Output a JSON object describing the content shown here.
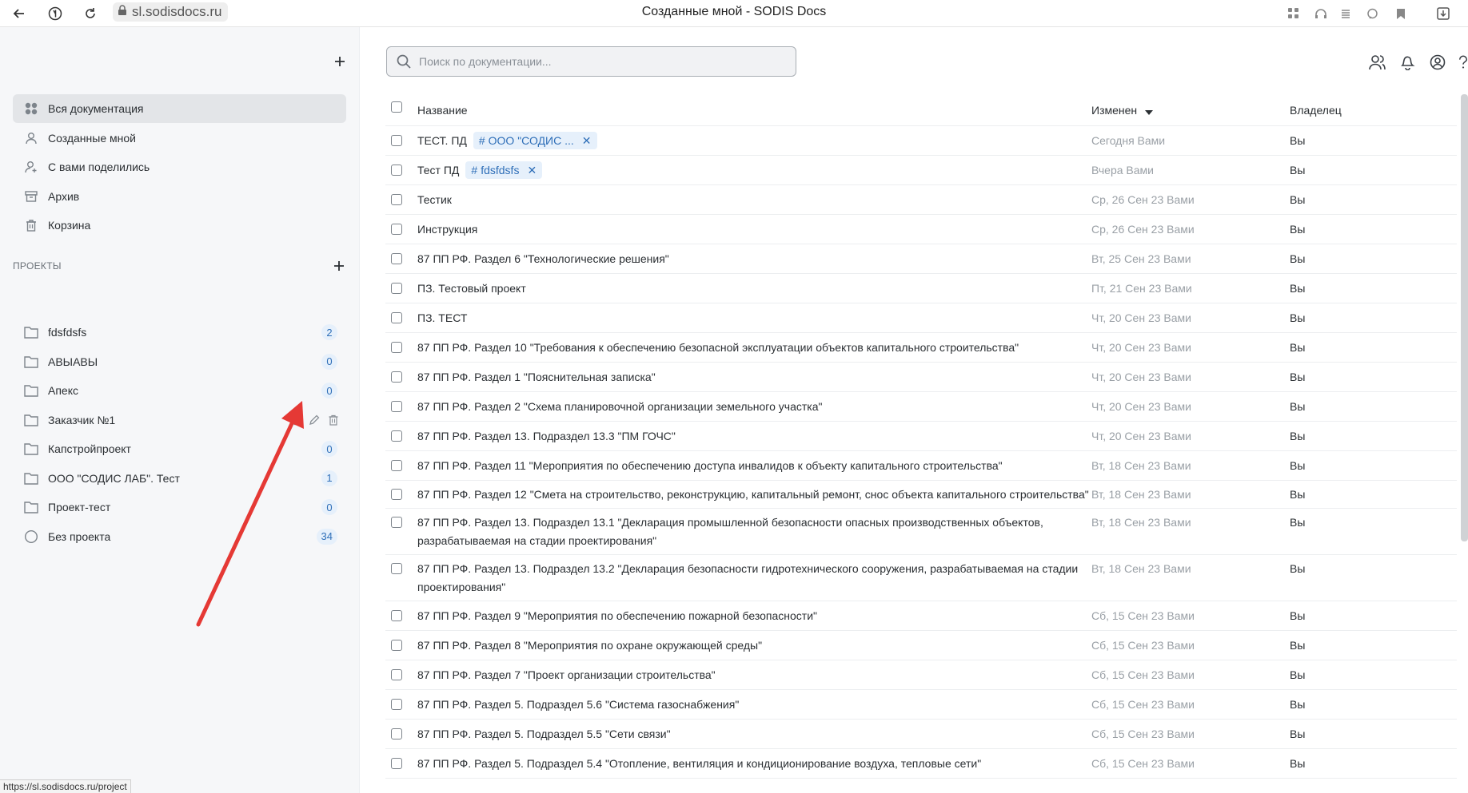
{
  "browser": {
    "url": "sl.sodisdocs.ru",
    "title": "Созданные мной - SODIS Docs",
    "status_url": "https://sl.sodisdocs.ru/project"
  },
  "colors": {
    "accent": "#2f6fb8",
    "tag_bg": "#e6f0fb",
    "sidebar_bg": "#f6f7f9",
    "annotation_arrow": "#e53935"
  },
  "sidebar": {
    "nav": [
      {
        "label": "Вся документация",
        "icon": "grid-icon",
        "active": true
      },
      {
        "label": "Созданные мной",
        "icon": "user-icon",
        "active": false
      },
      {
        "label": "С вами поделились",
        "icon": "shared-user-icon",
        "active": false
      },
      {
        "label": "Архив",
        "icon": "archive-icon",
        "active": false
      },
      {
        "label": "Корзина",
        "icon": "trash-icon",
        "active": false
      }
    ],
    "projects_label": "ПРОЕКТЫ",
    "projects": [
      {
        "label": "fdsfdsfs",
        "count": "2"
      },
      {
        "label": "АВЫАВЫ",
        "count": "0"
      },
      {
        "label": "Апекс",
        "count": "0"
      },
      {
        "label": "Заказчик №1",
        "count": ""
      },
      {
        "label": "Капстройпроект",
        "count": "0"
      },
      {
        "label": "ООО \"СОДИС ЛАБ\". Тест",
        "count": "1"
      },
      {
        "label": "Проект-тест",
        "count": "0"
      },
      {
        "label": "Без проекта",
        "count": "34"
      }
    ]
  },
  "search": {
    "placeholder": "Поиск по документации..."
  },
  "table": {
    "headers": {
      "name": "Название",
      "changed": "Изменен",
      "owner": "Владелец"
    },
    "rows": [
      {
        "name": "ТЕСТ. ПД",
        "tag": "ООО \"СОДИС ...",
        "changed": "Сегодня Вами",
        "owner": "Вы"
      },
      {
        "name": "Тест ПД",
        "tag": "fdsfdsfs",
        "changed": "Вчера Вами",
        "owner": "Вы"
      },
      {
        "name": "Тестик",
        "tag": "",
        "changed": "Ср, 26 Сен 23 Вами",
        "owner": "Вы"
      },
      {
        "name": "Инструкция",
        "tag": "",
        "changed": "Ср, 26 Сен 23 Вами",
        "owner": "Вы"
      },
      {
        "name": "87 ПП РФ. Раздел 6 \"Технологические решения\"",
        "tag": "",
        "changed": "Вт, 25 Сен 23 Вами",
        "owner": "Вы"
      },
      {
        "name": "ПЗ. Тестовый проект",
        "tag": "",
        "changed": "Пт, 21 Сен 23 Вами",
        "owner": "Вы"
      },
      {
        "name": "ПЗ. ТЕСТ",
        "tag": "",
        "changed": "Чт, 20 Сен 23 Вами",
        "owner": "Вы"
      },
      {
        "name": "87 ПП РФ. Раздел 10 \"Требования к обеспечению безопасной эксплуатации объектов капитального строительства\"",
        "tag": "",
        "changed": "Чт, 20 Сен 23 Вами",
        "owner": "Вы"
      },
      {
        "name": "87 ПП РФ. Раздел 1 \"Пояснительная записка\"",
        "tag": "",
        "changed": "Чт, 20 Сен 23 Вами",
        "owner": "Вы"
      },
      {
        "name": "87 ПП РФ. Раздел 2 \"Схема планировочной организации земельного участка\"",
        "tag": "",
        "changed": "Чт, 20 Сен 23 Вами",
        "owner": "Вы"
      },
      {
        "name": "87 ПП РФ. Раздел 13. Подраздел 13.3 \"ПМ ГОЧС\"",
        "tag": "",
        "changed": "Чт, 20 Сен 23 Вами",
        "owner": "Вы"
      },
      {
        "name": "87 ПП РФ. Раздел 11 \"Мероприятия по обеспечению доступа инвалидов к объекту капитального строительства\"",
        "tag": "",
        "changed": "Вт, 18 Сен 23 Вами",
        "owner": "Вы"
      },
      {
        "name": "87 ПП РФ. Раздел 12 \"Смета на строительство, реконструкцию, капитальный ремонт, снос объекта капитального строительства\"",
        "tag": "",
        "changed": "Вт, 18 Сен 23 Вами",
        "owner": "Вы"
      },
      {
        "name": "87 ПП РФ. Раздел 13. Подраздел 13.1 \"Декларация промышленной безопасности опасных производственных объектов, разрабатываемая на стадии проектирования\"",
        "tag": "",
        "changed": "Вт, 18 Сен 23 Вами",
        "owner": "Вы"
      },
      {
        "name": "87 ПП РФ. Раздел 13. Подраздел 13.2 \"Декларация безопасности гидротехнического сооружения, разрабатываемая на стадии проектирования\"",
        "tag": "",
        "changed": "Вт, 18 Сен 23 Вами",
        "owner": "Вы"
      },
      {
        "name": "87 ПП РФ. Раздел 9 \"Мероприятия по обеспечению пожарной безопасности\"",
        "tag": "",
        "changed": "Сб, 15 Сен 23 Вами",
        "owner": "Вы"
      },
      {
        "name": "87 ПП РФ. Раздел 8 \"Мероприятия по охране окружающей среды\"",
        "tag": "",
        "changed": "Сб, 15 Сен 23 Вами",
        "owner": "Вы"
      },
      {
        "name": "87 ПП РФ. Раздел 7 \"Проект организации строительства\"",
        "tag": "",
        "changed": "Сб, 15 Сен 23 Вами",
        "owner": "Вы"
      },
      {
        "name": "87 ПП РФ. Раздел 5. Подраздел 5.6 \"Система газоснабжения\"",
        "tag": "",
        "changed": "Сб, 15 Сен 23 Вами",
        "owner": "Вы"
      },
      {
        "name": "87 ПП РФ. Раздел 5. Подраздел 5.5 \"Сети связи\"",
        "tag": "",
        "changed": "Сб, 15 Сен 23 Вами",
        "owner": "Вы"
      },
      {
        "name": "87 ПП РФ. Раздел 5. Подраздел 5.4 \"Отопление, вентиляция и кондиционирование воздуха, тепловые сети\"",
        "tag": "",
        "changed": "Сб, 15 Сен 23 Вами",
        "owner": "Вы"
      }
    ]
  }
}
